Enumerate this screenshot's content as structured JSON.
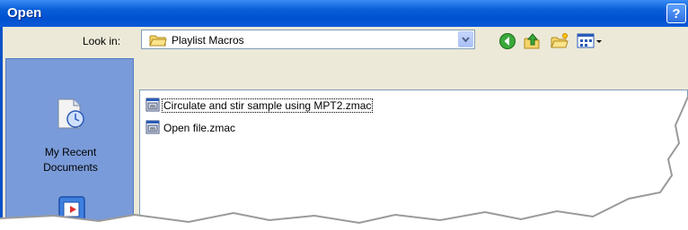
{
  "window": {
    "title": "Open",
    "help_label": "?"
  },
  "toolbar": {
    "look_in_label": "Look in:",
    "look_in_value": "Playlist Macros",
    "icons": [
      "back-icon",
      "up-folder-icon",
      "new-folder-icon",
      "view-menu-icon"
    ]
  },
  "places": {
    "items": [
      {
        "label_line1": "My Recent",
        "label_line2": "Documents",
        "icon": "recent-documents-icon"
      },
      {
        "icon": "desktop-icon"
      }
    ]
  },
  "files": [
    {
      "name": "Circulate and stir sample using MPT2.zmac",
      "icon": "macro-file-icon",
      "selected": true
    },
    {
      "name": "Open file.zmac",
      "icon": "macro-file-icon",
      "selected": false
    }
  ],
  "colors": {
    "titlebar": "#0050d0",
    "dialog_bg": "#ece9d8",
    "places_bar": "#7a9bd9"
  }
}
